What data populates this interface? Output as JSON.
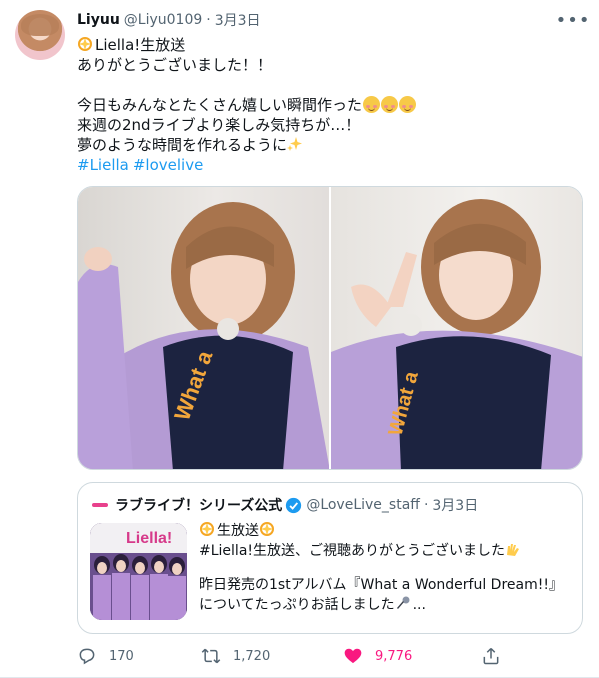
{
  "tweet": {
    "author_name": "Liyuu",
    "author_handle": "@Liyu0109",
    "dot": "·",
    "time": "3月3日",
    "more_icon": "more-icon",
    "lines": [
      "Liella!生放送",
      "ありがとうございました！！",
      "",
      "今日もみんなとたくさん嬉しい瞬間作った",
      "来週の2ndライブより楽しみ気持ちが…！",
      "夢のような時間を作れるように"
    ],
    "hashtags": [
      "#Liella",
      "#lovelive"
    ]
  },
  "quote": {
    "account_name": "ラブライブ！シリーズ公式",
    "handle": "@LoveLive_staff",
    "dot": "·",
    "time": "3月3日",
    "line1": "生放送",
    "line2": "#Liella!生放送、ご視聴ありがとうございました",
    "line3": "昨日発売の1stアルバム『What a Wonderful Dream!!』",
    "line4": "についてたっぷりお話しました",
    "thumb_text": "Liella!"
  },
  "actions": {
    "reply_count": "170",
    "retweet_count": "1,720",
    "like_count": "9,776"
  },
  "colors": {
    "text": "#0f1419",
    "secondary": "#536471",
    "link": "#1d9bf0",
    "like": "#f91880",
    "border": "#cfd9de"
  }
}
